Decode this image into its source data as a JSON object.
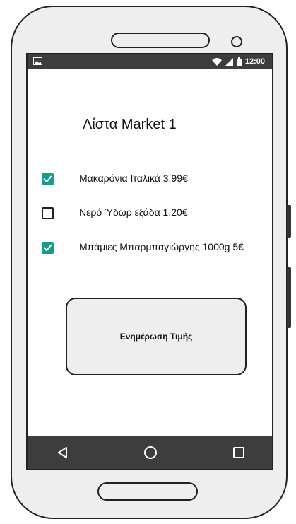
{
  "status_bar": {
    "time": "12:00",
    "icons": [
      "image-icon",
      "wifi-icon",
      "signal-icon",
      "battery-icon"
    ]
  },
  "screen": {
    "title": "Λίστα Market 1"
  },
  "shopping_list": {
    "items": [
      {
        "label": "Μακαρόνια Ιταλικά 3.99€",
        "checked": true
      },
      {
        "label": "Νερό Ύδωρ εξάδα 1.20€",
        "checked": false
      },
      {
        "label": "Μπάμιες Μπαρμπαγιώργης 1000g 5€",
        "checked": true
      }
    ]
  },
  "actions": {
    "update_price_label": "Ενημέρωση Τιμής"
  },
  "navigation": {
    "icons": [
      "back-icon",
      "home-icon",
      "recents-icon"
    ]
  },
  "colors": {
    "checkbox_checked": "#1a9a8b",
    "bar_background": "#3d3d3d",
    "device_body": "#eeeeee"
  }
}
